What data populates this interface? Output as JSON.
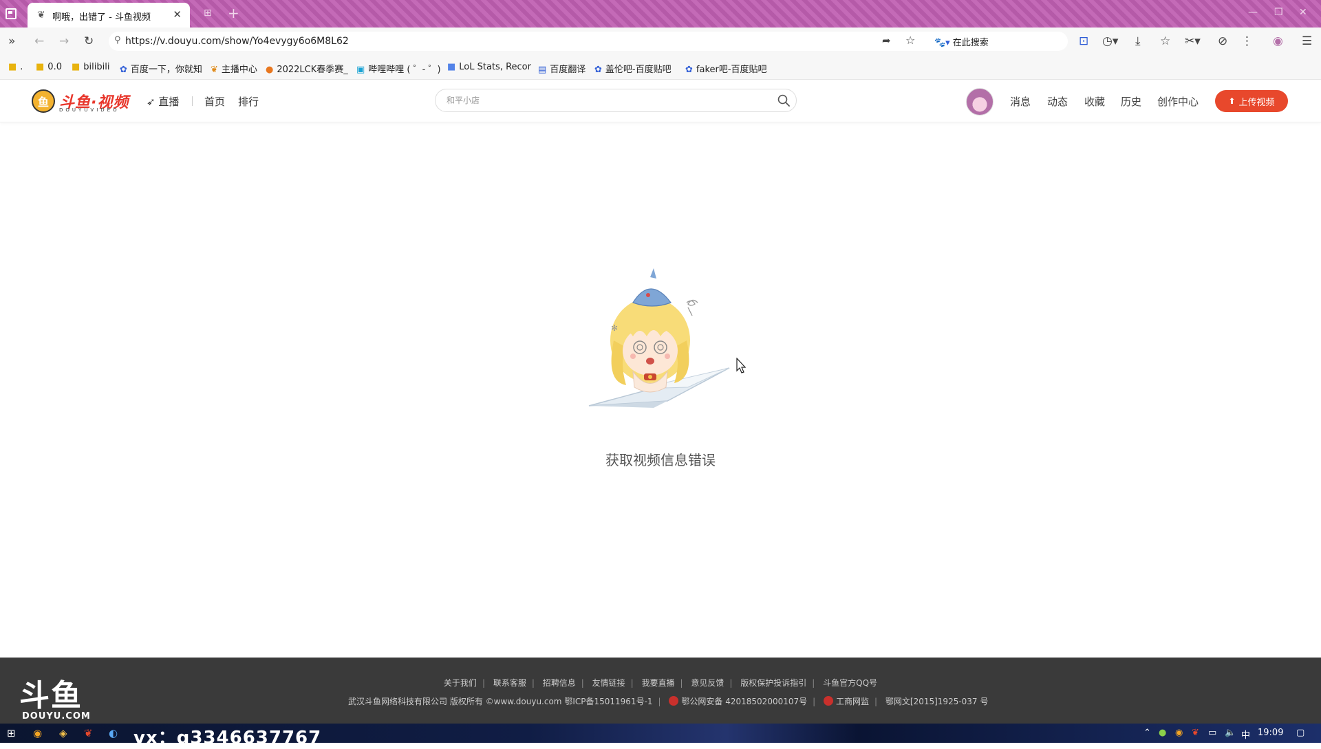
{
  "browser": {
    "tab_title": "啊哦，出错了 - 斗鱼视频",
    "url": "https://v.douyu.com/show/Yo4evygy6o6M8L62",
    "search_engine_label": "在此搜索",
    "bookmarks": [
      {
        "label": ".",
        "icon": "folder-icon"
      },
      {
        "label": "0.0",
        "icon": "folder-icon"
      },
      {
        "label": "bilibili",
        "icon": "folder-icon"
      },
      {
        "label": "百度一下，你就知",
        "icon": "baidu-paw-icon"
      },
      {
        "label": "主播中心",
        "icon": "douyu-icon"
      },
      {
        "label": "2022LCK春季赛_",
        "icon": "orange-site-icon"
      },
      {
        "label": "哔哩哔哩 ( ゜- ゜)",
        "icon": "bilibili-tv-icon"
      },
      {
        "label": "LoL Stats, Recor",
        "icon": "opgg-icon"
      },
      {
        "label": "百度翻译",
        "icon": "baidu-translate-icon"
      },
      {
        "label": "盖伦吧-百度贴吧",
        "icon": "baidu-paw-icon"
      },
      {
        "label": "faker吧-百度贴吧",
        "icon": "baidu-paw-icon"
      }
    ]
  },
  "site_header": {
    "logo_text": "斗鱼·视频",
    "logo_sub": "DOUYUVIDEO",
    "nav_live": "直播",
    "nav_home": "首页",
    "nav_rank": "排行",
    "search_placeholder": "和平小店",
    "right_nav": [
      "消息",
      "动态",
      "收藏",
      "历史",
      "创作中心"
    ],
    "upload_label": "上传视频"
  },
  "main": {
    "error_message": "获取视频信息错误"
  },
  "footer": {
    "logo_big": "斗鱼",
    "logo_small": "DOUYU.COM",
    "links": [
      "关于我们",
      "联系客服",
      "招聘信息",
      "友情链接",
      "我要直播",
      "意见反馈",
      "版权保护投诉指引",
      "斗鱼官方QQ号"
    ],
    "company": "武汉斗鱼网络科技有限公司 版权所有 ©www.douyu.com",
    "icp": "鄂ICP备15011961号-1",
    "police": "鄂公网安备 42018502000107号",
    "biz": "工商网监",
    "culture": "鄂网文[2015]1925-037 号"
  },
  "taskbar": {
    "overlay_text": "vx：q3346637767",
    "ime": "中",
    "clock": "19:09"
  }
}
